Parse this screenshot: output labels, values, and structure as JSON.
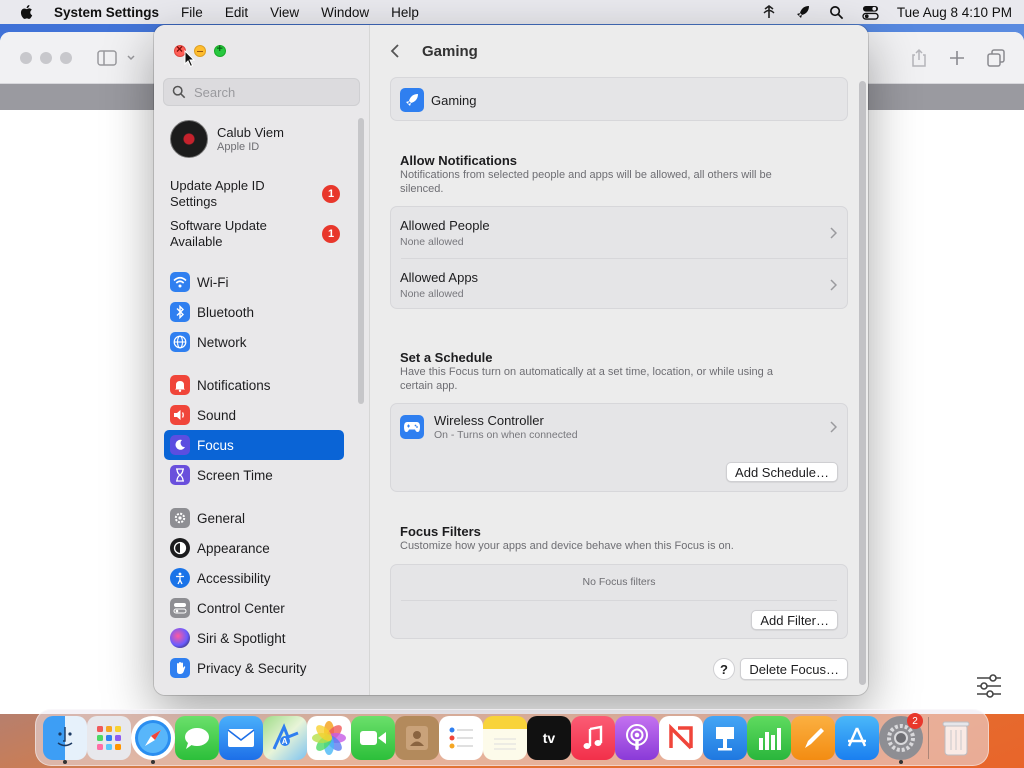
{
  "menubar": {
    "app_name": "System Settings",
    "menus": [
      "File",
      "Edit",
      "View",
      "Window",
      "Help"
    ],
    "datetime": "Tue Aug 8  4:10 PM"
  },
  "sidebar": {
    "search_placeholder": "Search",
    "profile": {
      "name": "Calub Viem",
      "subtitle": "Apple ID"
    },
    "updates": [
      {
        "label": "Update Apple ID Settings",
        "badge": "1"
      },
      {
        "label": "Software Update Available",
        "badge": "1"
      }
    ],
    "items": [
      {
        "label": "Wi-Fi",
        "icon": "wifi-icon",
        "color": "#2f7ff0"
      },
      {
        "label": "Bluetooth",
        "icon": "bluetooth-icon",
        "color": "#2f7ff0"
      },
      {
        "label": "Network",
        "icon": "globe-icon",
        "color": "#2f7ff0"
      },
      {
        "label": "Notifications",
        "icon": "bell-icon",
        "color": "#f0453a"
      },
      {
        "label": "Sound",
        "icon": "speaker-icon",
        "color": "#f0453a"
      },
      {
        "label": "Focus",
        "icon": "moon-icon",
        "color": "#5b4ee0",
        "selected": true
      },
      {
        "label": "Screen Time",
        "icon": "hourglass-icon",
        "color": "#6a4fdc"
      },
      {
        "label": "General",
        "icon": "gear-icon",
        "color": "#8e8e93"
      },
      {
        "label": "Appearance",
        "icon": "appearance-icon",
        "color": "#1c1c1e"
      },
      {
        "label": "Accessibility",
        "icon": "accessibility-icon",
        "color": "#1a73e8"
      },
      {
        "label": "Control Center",
        "icon": "control-center-icon",
        "color": "#8e8e93"
      },
      {
        "label": "Siri & Spotlight",
        "icon": "siri-icon",
        "color": "#2b2b2b"
      },
      {
        "label": "Privacy & Security",
        "icon": "hand-icon",
        "color": "#2f7ff0"
      }
    ]
  },
  "content": {
    "title": "Gaming",
    "focus_name": "Gaming",
    "allow_notifications": {
      "title": "Allow Notifications",
      "description": "Notifications from selected people and apps will be allowed, all others will be silenced.",
      "rows": [
        {
          "title": "Allowed People",
          "subtitle": "None allowed"
        },
        {
          "title": "Allowed Apps",
          "subtitle": "None allowed"
        }
      ]
    },
    "schedule": {
      "title": "Set a Schedule",
      "description": "Have this Focus turn on automatically at a set time, location, or while using a certain app.",
      "row": {
        "title": "Wireless Controller",
        "subtitle": "On - Turns on when connected"
      },
      "add_button": "Add Schedule…"
    },
    "filters": {
      "title": "Focus Filters",
      "description": "Customize how your apps and device behave when this Focus is on.",
      "empty_text": "No Focus filters",
      "add_button": "Add Filter…"
    },
    "help_label": "?",
    "delete_button": "Delete Focus…"
  },
  "dock": {
    "apps": [
      "Finder",
      "Launchpad",
      "Safari",
      "Messages",
      "Mail",
      "Maps",
      "Photos",
      "FaceTime",
      "Contacts",
      "Reminders",
      "Notes",
      "TV",
      "Music",
      "Podcasts",
      "News",
      "Keynote",
      "Numbers",
      "Pages",
      "App Store",
      "System Settings",
      "Trash"
    ],
    "tv_label": "tv",
    "settings_badge": "2"
  }
}
